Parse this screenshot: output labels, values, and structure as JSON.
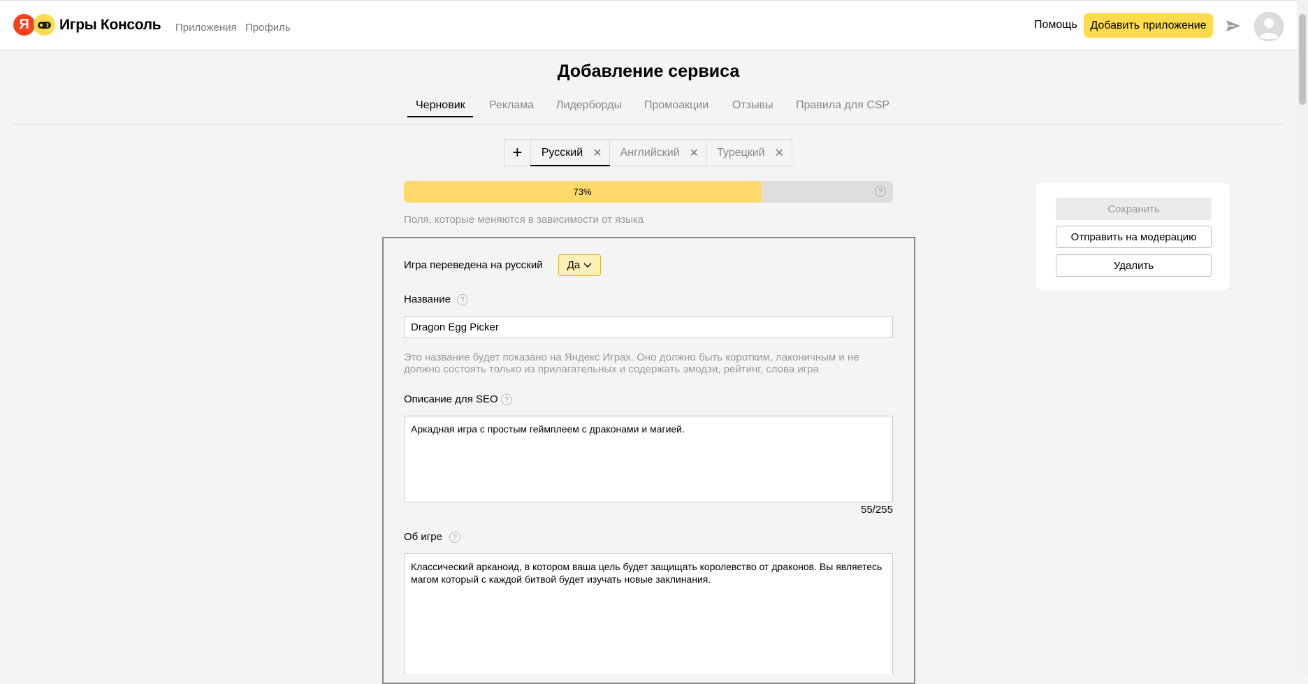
{
  "header": {
    "logo_letter": "Я",
    "logo_text": "Игры Консоль",
    "nav": [
      "Приложения",
      "Профиль"
    ],
    "help": "Помощь",
    "add_app": "Добавить приложение"
  },
  "page": {
    "title": "Добавление сервиса",
    "tabs": [
      "Черновик",
      "Реклама",
      "Лидерборды",
      "Промоакции",
      "Отзывы",
      "Правила для CSP"
    ],
    "active_tab": "Черновик"
  },
  "languages": {
    "add_symbol": "+",
    "tabs": [
      "Русский",
      "Английский",
      "Турецкий"
    ],
    "active": "Русский",
    "close_symbol": "✕"
  },
  "progress": {
    "value": 0.73,
    "label": "73%",
    "help": "?",
    "caption": "Поля, которые меняются в зависимости от языка"
  },
  "form": {
    "translated_label": "Игра переведена на русский",
    "translated_value": "Да",
    "name_label": "Название",
    "name_value": "Dragon Egg Picker",
    "name_hint": "Это название будет показано на Яндекс Играх. Оно должно быть коротким, лаконичным и не должно состоять только из прилагательных и содержать эмодзи, рейтинг, слова игра",
    "seo_label": "Описание для SEO",
    "seo_value": "Аркадная игра с простым геймплеем с драконами и магией.",
    "seo_counter": "55/255",
    "about_label": "Об игре",
    "about_value": "Классический арканоид, в котором ваша цель будет защищать королевство от драконов. Вы являетесь магом который с каждой битвой будет изучать новые заклинания.",
    "help": "?"
  },
  "actions": {
    "save": "Сохранить",
    "moderate": "Отправить на модерацию",
    "delete": "Удалить"
  },
  "colors": {
    "accent": "#ffdb4d",
    "progress_fill": "#fed86a",
    "yandex_red": "#fc3f1d"
  }
}
